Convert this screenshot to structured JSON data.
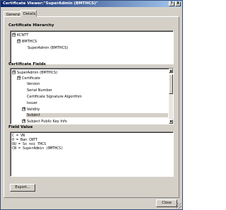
{
  "window": {
    "title": "Certificate Viewer:\"SuperAdmin (BMTHCS)\"",
    "controls": [
      "?",
      "X"
    ]
  },
  "tabs": [
    {
      "label": "General",
      "active": false
    },
    {
      "label": "Details",
      "active": true
    }
  ],
  "hierarchy": {
    "label": "Certificate Hierarchy",
    "items": [
      {
        "text": "KCNTT",
        "expander": "⊟"
      },
      {
        "text": "BMTHCS",
        "expander": "⊟"
      },
      {
        "text": "SuperAdmin (BMTHCS)",
        "expander": ""
      }
    ]
  },
  "fields": {
    "label": "Certificate Fields",
    "items": [
      {
        "text": "SuperAdmin (BMTHCS)",
        "expander": "⊟"
      },
      {
        "text": "Certificate",
        "expander": "⊟"
      },
      {
        "text": "Version",
        "expander": ""
      },
      {
        "text": "Serial Number",
        "expander": ""
      },
      {
        "text": "Certificate Signature Algorithm",
        "expander": ""
      },
      {
        "text": "Issuer",
        "expander": ""
      },
      {
        "text": "Validity",
        "expander": "⊞"
      },
      {
        "text": "Subject",
        "expander": "",
        "selected": true
      },
      {
        "text": "Subject Public Key Info",
        "expander": "⊞"
      }
    ]
  },
  "field_value": {
    "label": "Field Value",
    "lines": [
      "C = VN",
      "O = Ban CNTT",
      "OU = So noi THCS",
      "CN = SuperAdmin (BMTHCS)"
    ]
  },
  "buttons": {
    "export": "Export...",
    "close": "Close"
  }
}
